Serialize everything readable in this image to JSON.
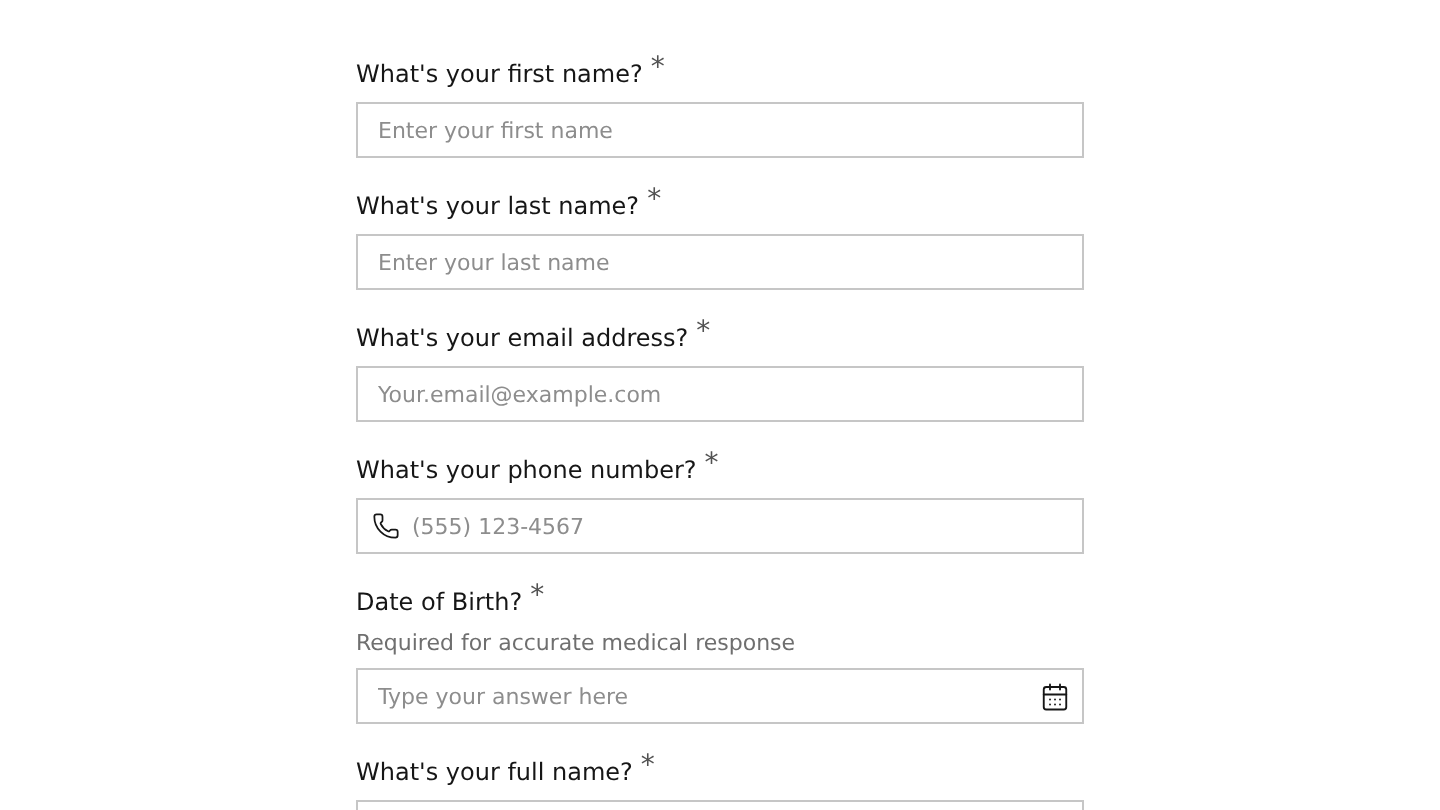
{
  "fields": [
    {
      "kind": "text",
      "label": "What's your first name?",
      "required_mark": "*",
      "placeholder": "Enter your first name"
    },
    {
      "kind": "text",
      "label": "What's your last name?",
      "required_mark": "*",
      "placeholder": "Enter your last name"
    },
    {
      "kind": "text",
      "label": "What's your email address?",
      "required_mark": "*",
      "placeholder": "Your.email@example.com"
    },
    {
      "kind": "phone",
      "label": "What's your phone number?",
      "required_mark": "*",
      "placeholder": "(555) 123-4567"
    },
    {
      "kind": "date",
      "label": "Date of Birth?",
      "required_mark": "*",
      "hint": "Required for accurate medical response",
      "placeholder": "Type your answer here"
    },
    {
      "kind": "text",
      "label": "What's your full name?",
      "required_mark": "*"
    }
  ]
}
